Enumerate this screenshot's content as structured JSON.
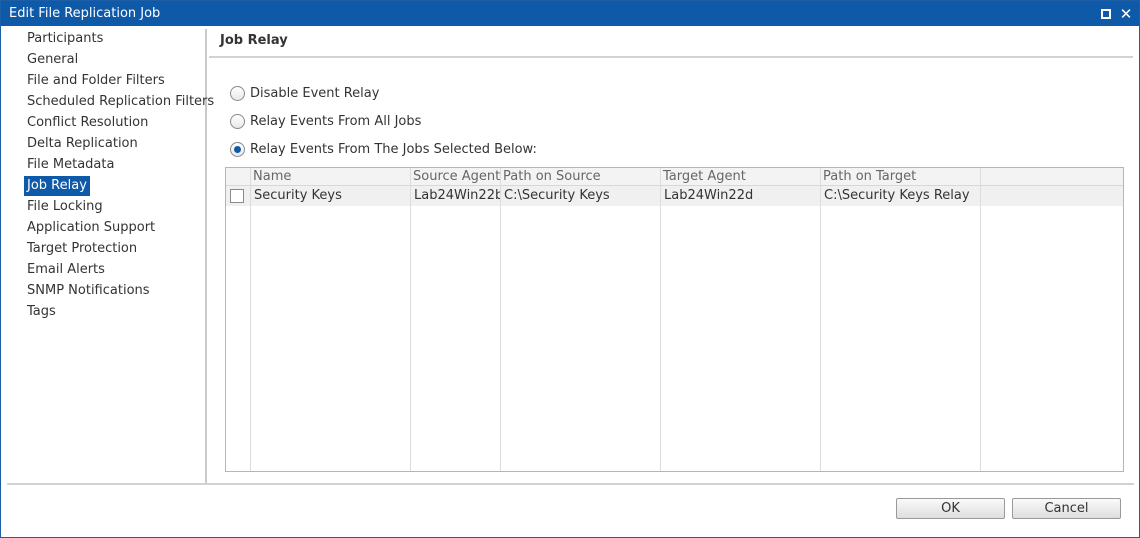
{
  "window": {
    "title": "Edit File Replication Job",
    "accent_color": "#0f5aa8",
    "controls": [
      "maximize-icon",
      "close-icon"
    ]
  },
  "sidebar": {
    "items": [
      {
        "label": "Participants",
        "selected": false
      },
      {
        "label": "General",
        "selected": false
      },
      {
        "label": "File and Folder Filters",
        "selected": false
      },
      {
        "label": "Scheduled Replication Filters",
        "selected": false
      },
      {
        "label": "Conflict Resolution",
        "selected": false
      },
      {
        "label": "Delta Replication",
        "selected": false
      },
      {
        "label": "File Metadata",
        "selected": false
      },
      {
        "label": "Job Relay",
        "selected": true
      },
      {
        "label": "File Locking",
        "selected": false
      },
      {
        "label": "Application Support",
        "selected": false
      },
      {
        "label": "Target Protection",
        "selected": false
      },
      {
        "label": "Email Alerts",
        "selected": false
      },
      {
        "label": "SNMP Notifications",
        "selected": false
      },
      {
        "label": "Tags",
        "selected": false
      }
    ]
  },
  "main": {
    "title": "Job Relay",
    "options": [
      {
        "label": "Disable Event Relay",
        "checked": false
      },
      {
        "label": "Relay Events From All Jobs",
        "checked": false
      },
      {
        "label": "Relay Events From The Jobs Selected Below:",
        "checked": true
      }
    ],
    "table": {
      "columns": [
        "Name",
        "Source Agent",
        "Path on Source",
        "Target Agent",
        "Path on Target"
      ],
      "rows": [
        {
          "checked": false,
          "cells": [
            "Security Keys",
            "Lab24Win22b",
            "C:\\Security Keys",
            "Lab24Win22d",
            "C:\\Security Keys Relay"
          ]
        }
      ]
    }
  },
  "footer": {
    "ok_label": "OK",
    "cancel_label": "Cancel"
  }
}
